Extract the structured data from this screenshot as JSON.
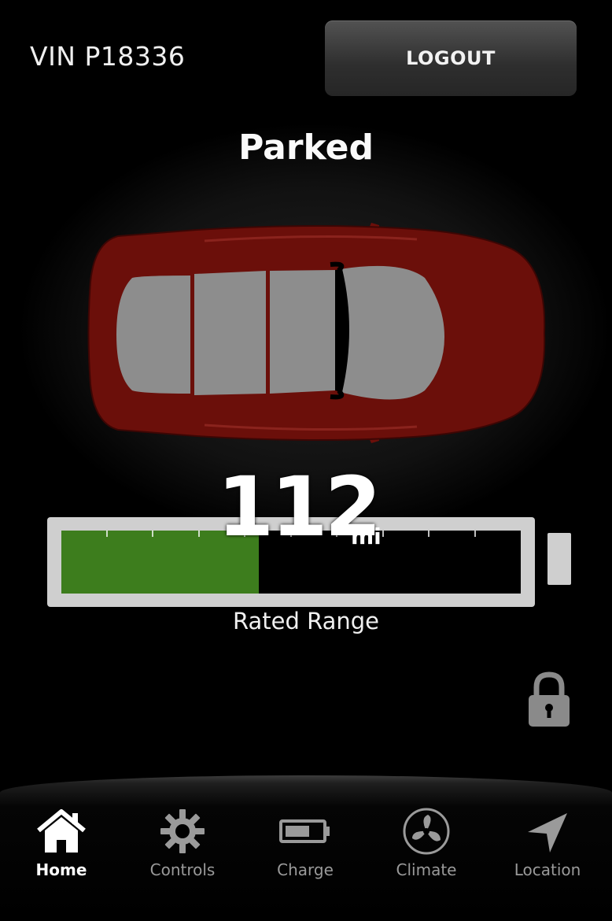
{
  "header": {
    "vin": "VIN P18336",
    "logout_label": "LOGOUT"
  },
  "vehicle": {
    "status": "Parked",
    "color": "#6b0f0a",
    "locked": true
  },
  "range": {
    "value": "112",
    "unit": "mi",
    "label": "Rated Range",
    "fill_fraction": 0.43,
    "fill_color": "#3d7d1d"
  },
  "nav": {
    "items": [
      {
        "label": "Home",
        "icon": "home-icon",
        "active": true
      },
      {
        "label": "Controls",
        "icon": "gear-icon",
        "active": false
      },
      {
        "label": "Charge",
        "icon": "battery-icon",
        "active": false
      },
      {
        "label": "Climate",
        "icon": "fan-icon",
        "active": false
      },
      {
        "label": "Location",
        "icon": "location-arrow-icon",
        "active": false
      }
    ]
  }
}
